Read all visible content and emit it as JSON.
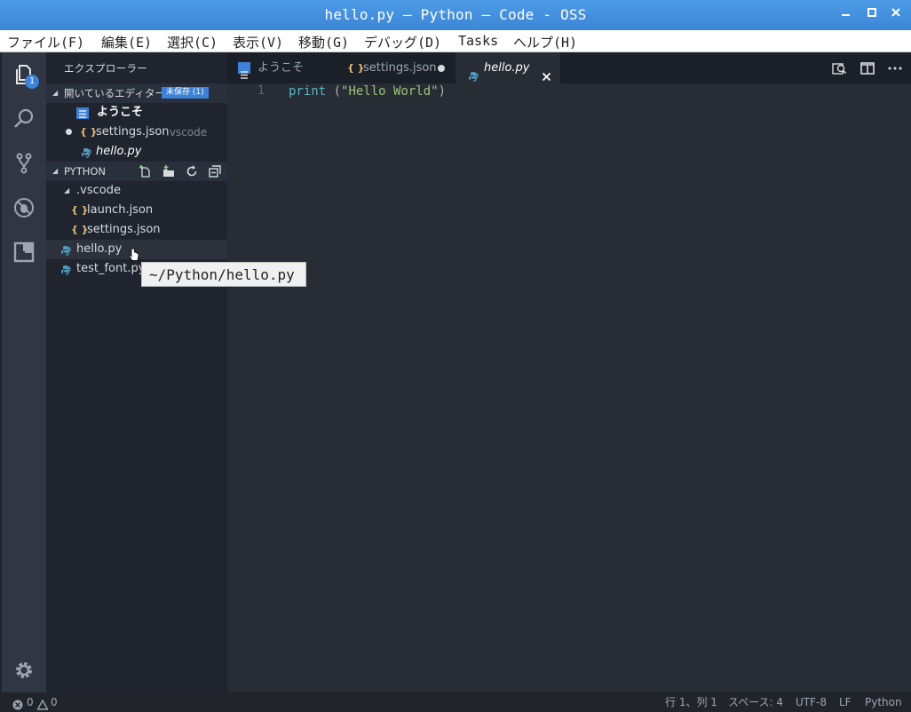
{
  "window": {
    "title": "hello.py — Python — Code - OSS"
  },
  "menu": [
    "ファイル(F)",
    "編集(E)",
    "選択(C)",
    "表示(V)",
    "移動(G)",
    "デバッグ(D)",
    "Tasks",
    "ヘルプ(H)"
  ],
  "activity_bar": {
    "explorer_badge": "1",
    "items": [
      "files-icon",
      "search-icon",
      "source-control-icon",
      "debug-icon",
      "extensions-icon",
      "gear-icon"
    ]
  },
  "sidebar": {
    "title": "エクスプローラー",
    "open_editors": {
      "label": "開いているエディター",
      "badge": "未保存 (1)",
      "items": [
        {
          "name": "ようこそ",
          "hint": ""
        },
        {
          "name": "settings.json",
          "hint": ".vscode"
        },
        {
          "name": "hello.py",
          "hint": ""
        }
      ]
    },
    "folder": {
      "label": "PYTHON",
      "subfolder": ".vscode",
      "sub_items": [
        "launch.json",
        "settings.json"
      ],
      "files": [
        "hello.py",
        "test_font.py"
      ]
    }
  },
  "tooltip": "~/Python/hello.py",
  "tabs": [
    {
      "label": "ようこそ"
    },
    {
      "label": "settings.json"
    },
    {
      "label": "hello.py"
    }
  ],
  "editor": {
    "line_number": "1",
    "code": {
      "keyword": "print",
      "paren_open": " (",
      "string": "\"Hello World\"",
      "paren_close": ")"
    }
  },
  "statusbar": {
    "errors": "0",
    "warnings": "0",
    "position": "行 1、列 1",
    "spaces": "スペース: 4",
    "encoding": "UTF-8",
    "eol": "LF",
    "language": "Python"
  },
  "colors": {
    "accent": "#3b82d8",
    "title_bar": "#4a96e2",
    "editor_bg": "#282c34",
    "sidebar_bg": "#1f242e",
    "activity_bg": "#303642"
  }
}
